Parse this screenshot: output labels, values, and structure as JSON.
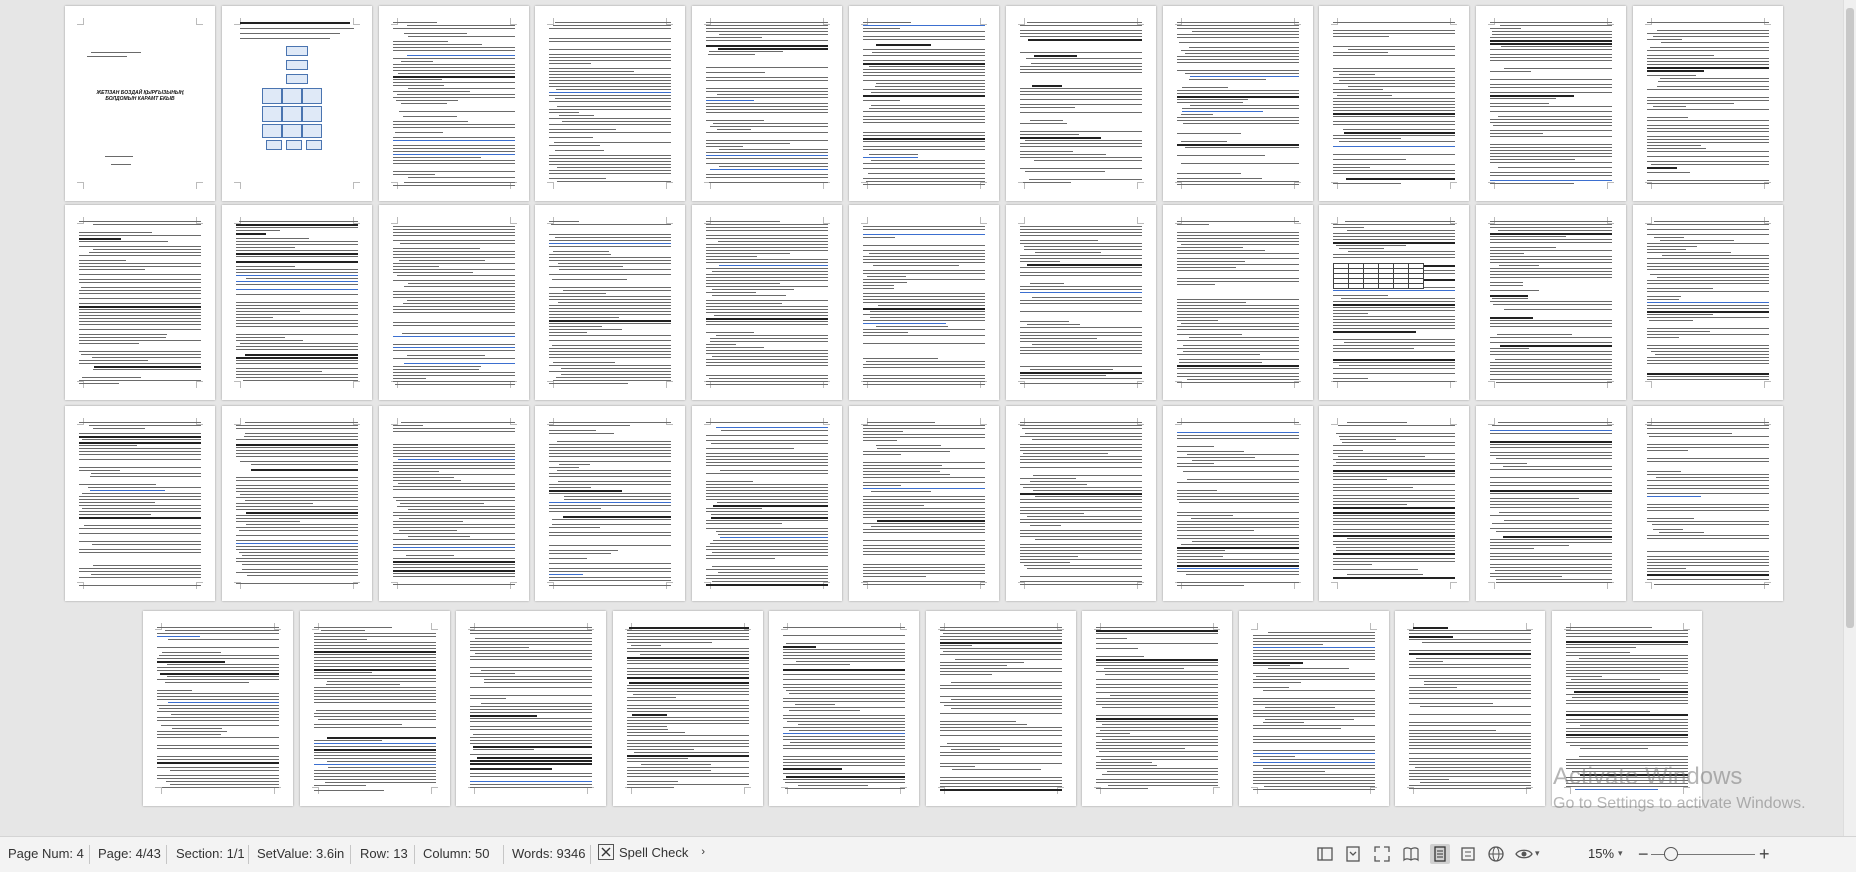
{
  "status_bar": {
    "page_num": "Page Num: 4",
    "page": "Page: 4/43",
    "section": "Section: 1/1",
    "set_value": "SetValue: 3.6in",
    "row": "Row: 13",
    "column": "Column: 50",
    "words": "Words: 9346",
    "spell_check": "Spell Check",
    "zoom": "15%",
    "zoom_out": "−",
    "zoom_in": "+"
  },
  "view_icons": [
    "navigation-pane-icon",
    "outline-icon",
    "full-screen-icon",
    "read-mode-icon",
    "page-view-icon",
    "web-layout-icon",
    "globe-icon",
    "eye-protection-icon"
  ],
  "document": {
    "total_pages": 43,
    "cover_title_line1": "ЖЕТІЗАН БОЗДАЙ ҚЫРҒЫЗЫНЫҢ",
    "cover_title_line2": "БОЛДОМЫН КАРАМТ ЕКЫВ"
  },
  "activation_notice": {
    "heading": "Activate Windows",
    "subtext": "Go to Settings to activate Windows."
  },
  "colors": {
    "canvas": "#e6e6e6",
    "page": "#ffffff",
    "text_line": "#6a6a6a",
    "link": "#3b6fd0",
    "status_bar": "#f3f3f3"
  }
}
